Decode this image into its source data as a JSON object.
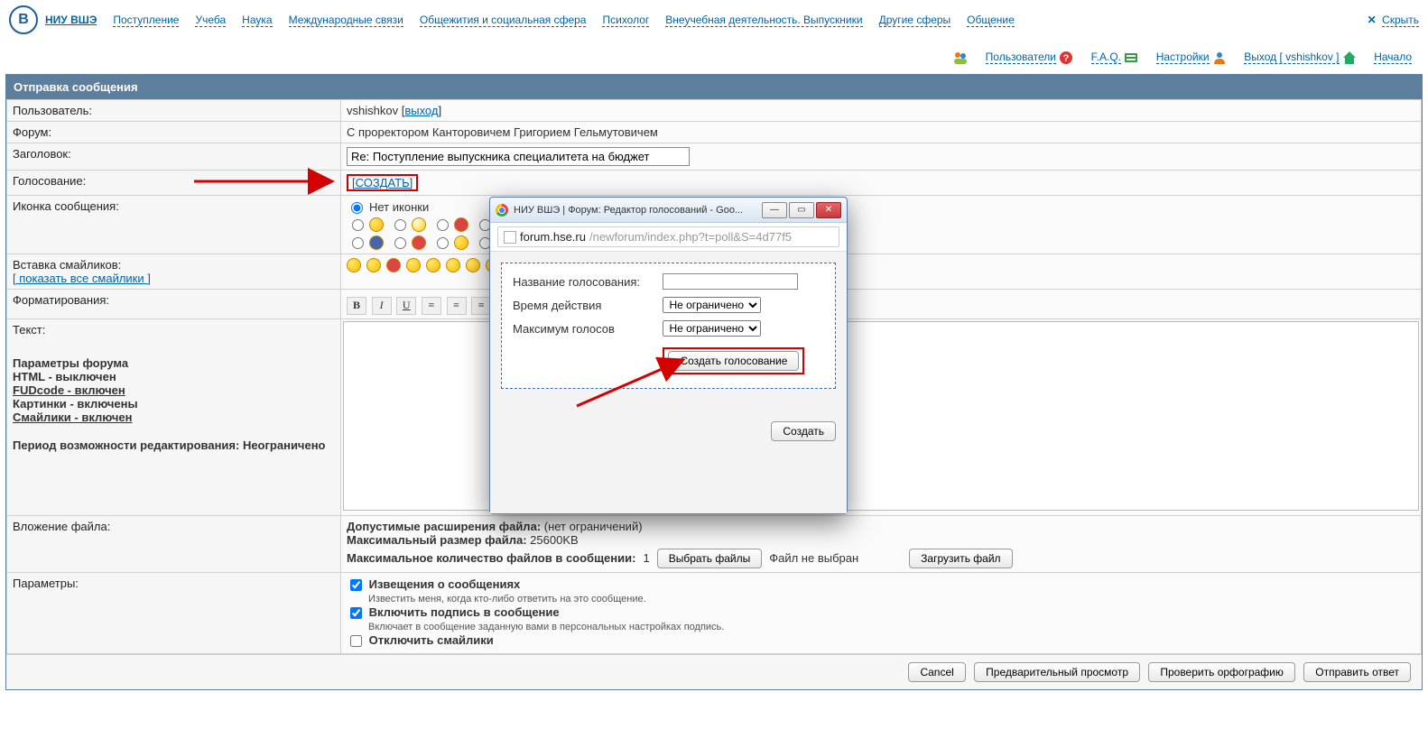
{
  "topnav": {
    "brand": "НИУ ВШЭ",
    "items": [
      "Поступление",
      "Учеба",
      "Наука",
      "Международные связи",
      "Общежития и социальная сфера",
      "Психолог",
      "Внеучебная деятельность. Выпускники",
      "Другие сферы",
      "Общение"
    ],
    "hide": "Скрыть"
  },
  "actionbar": {
    "users": "Пользователи",
    "faq": "F.A.Q.",
    "settings": "Настройки",
    "logout": "Выход [ vshishkov ]",
    "home": "Начало"
  },
  "section_title": "Отправка сообщения",
  "labels": {
    "user": "Пользователь:",
    "forum": "Форум:",
    "subject": "Заголовок:",
    "poll": "Голосование:",
    "icon": "Иконка сообщения:",
    "smilies_insert": "Вставка смайликов:",
    "show_all_smilies": "[ показать все смайлики ]",
    "formatting": "Форматирования:",
    "text": "Текст:",
    "attach": "Вложение файла:",
    "params": "Параметры:"
  },
  "user": {
    "name": "vshishkov",
    "logout_link": "выход"
  },
  "forum_name": "С проректором Канторовичем Григорием Гельмутовичем",
  "subject_value": "Re: Поступление выпускника специалитета на бюджет",
  "poll_create": "[СОЗДАТЬ]",
  "no_icon_label": "Нет иконки",
  "sidebar": {
    "params_title": "Параметры форума",
    "html_off": "HTML - выключен",
    "fudcode_on": "FUDcode - включен",
    "images_on": "Картинки - включены",
    "smilies_on": "Смайлики - включен",
    "edit_period": "Период возможности редактирования: Неограничено"
  },
  "attach": {
    "ext_label": "Допустимые расширения файла:",
    "ext_value": "(нет ограничений)",
    "max_size_label": "Максимальный размер файла:",
    "max_size_value": "25600KB",
    "max_count_label": "Максимальное количество файлов в сообщении:",
    "max_count_value": "1",
    "choose_btn": "Выбрать файлы",
    "no_file": "Файл не выбран",
    "upload_btn": "Загрузить файл"
  },
  "options": {
    "notify_title": "Извещения о сообщениях",
    "notify_sub": "Известить меня, когда кто-либо ответить на это сообщение.",
    "sig_title": "Включить подпись в сообщение",
    "sig_sub": "Включает в сообщение заданную вами в персональных настройках подпись.",
    "disable_smilies": "Отключить смайлики"
  },
  "buttons": {
    "cancel": "Cancel",
    "preview": "Предварительный просмотр",
    "spellcheck": "Проверить орфографию",
    "submit": "Отправить ответ"
  },
  "popup": {
    "title": "НИУ ВШЭ | Форум: Редактор голосований - Goo...",
    "url_host": "forum.hse.ru",
    "url_path": "/newforum/index.php?t=poll&S=4d77f5",
    "poll_name_label": "Название голосования:",
    "duration_label": "Время действия",
    "max_votes_label": "Максимум голосов",
    "unlimited": "Не ограничено",
    "create_poll_btn": "Создать голосование",
    "create_btn": "Создать"
  }
}
